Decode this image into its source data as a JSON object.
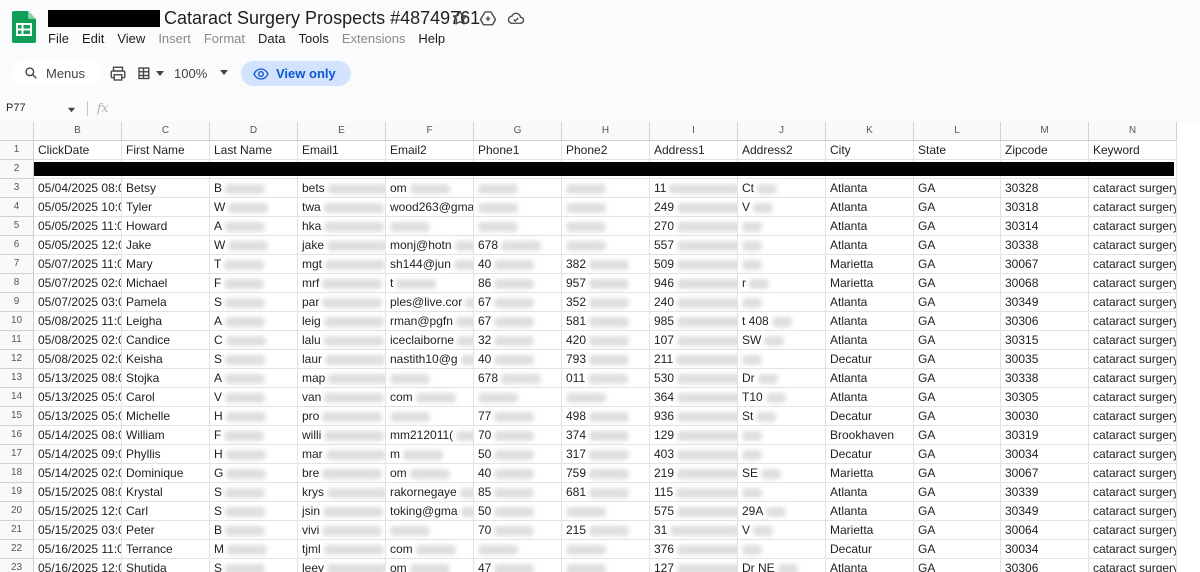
{
  "window": {
    "doc_title": "Cataract Surgery Prospects #48749761"
  },
  "menu": [
    {
      "label": "File",
      "enabled": true
    },
    {
      "label": "Edit",
      "enabled": true
    },
    {
      "label": "View",
      "enabled": true
    },
    {
      "label": "Insert",
      "enabled": false
    },
    {
      "label": "Format",
      "enabled": false
    },
    {
      "label": "Data",
      "enabled": true
    },
    {
      "label": "Tools",
      "enabled": true
    },
    {
      "label": "Extensions",
      "enabled": false
    },
    {
      "label": "Help",
      "enabled": true
    }
  ],
  "toolbar": {
    "menus_label": "Menus",
    "zoom": "100%",
    "view_only_label": "View only"
  },
  "formula_bar": {
    "cell_ref": "P77",
    "fx_label": "fx"
  },
  "colors": {
    "accent": "#0b57d0",
    "view_only_bg": "#d3e3fd",
    "sheets_green": "#0f9d58"
  },
  "grid": {
    "columns": [
      "B",
      "C",
      "D",
      "E",
      "F",
      "G",
      "H",
      "I",
      "J",
      "K",
      "L",
      "M",
      "N"
    ],
    "headers": [
      "ClickDate",
      "First Name",
      "Last Name",
      "Email1",
      "Email2",
      "Phone1",
      "Phone2",
      "Address1",
      "Address2",
      "City",
      "State",
      "Zipcode",
      "Keyword"
    ],
    "row_numbers": [
      "1",
      "2",
      "3",
      "4",
      "5",
      "6",
      "7",
      "8",
      "9",
      "10",
      "11",
      "12",
      "13",
      "14",
      "15",
      "16",
      "17",
      "18",
      "19",
      "20",
      "21",
      "22",
      "23"
    ],
    "rows": [
      [
        "05/04/2025 08:0",
        "Betsy",
        "B",
        "bets",
        "om",
        "",
        "",
        "11",
        "Ct",
        "Atlanta",
        "GA",
        "30328",
        "cataract surgery"
      ],
      [
        "05/05/2025 10:0",
        "Tyler",
        "W",
        "twa",
        "wood263@gma",
        "",
        "",
        "249",
        "V",
        "Atlanta",
        "GA",
        "30318",
        "cataract surgery"
      ],
      [
        "05/05/2025 11:0",
        "Howard",
        "A",
        "hka",
        "",
        "",
        "",
        "270",
        "",
        "Atlanta",
        "GA",
        "30314",
        "cataract surgery"
      ],
      [
        "05/05/2025 12:0",
        "Jake",
        "W",
        "jake",
        "monj@hotn",
        "678",
        "",
        "557",
        "",
        "Atlanta",
        "GA",
        "30338",
        "cataract surgery"
      ],
      [
        "05/07/2025 11:0",
        "Mary",
        "T",
        "mgt",
        "sh144@jun",
        "40",
        "382",
        "509",
        "",
        "Marietta",
        "GA",
        "30067",
        "cataract surgery"
      ],
      [
        "05/07/2025 02:0",
        "Michael",
        "F",
        "mrf",
        "t",
        "86",
        "957",
        "946",
        "r",
        "Marietta",
        "GA",
        "30068",
        "cataract surgery"
      ],
      [
        "05/07/2025 03:0",
        "Pamela",
        "S",
        "par",
        "ples@live.cor",
        "67",
        "352",
        "240",
        "",
        "Atlanta",
        "GA",
        "30349",
        "cataract surgery"
      ],
      [
        "05/08/2025 11:0",
        "Leigha",
        "A",
        "leig",
        "rman@pgfn",
        "67",
        "581",
        "985",
        "t 408",
        "Atlanta",
        "GA",
        "30306",
        "cataract surgery"
      ],
      [
        "05/08/2025 02:0",
        "Candice",
        "C",
        "lalu",
        "iceclaiborne",
        "32",
        "420",
        "107",
        "SW",
        "Atlanta",
        "GA",
        "30315",
        "cataract surgery"
      ],
      [
        "05/08/2025 02:0",
        "Keisha",
        "S",
        "laur",
        "nastith10@g",
        "40",
        "793",
        "211",
        "",
        "Decatur",
        "GA",
        "30035",
        "cataract surgery"
      ],
      [
        "05/13/2025 08:0",
        "Stojka",
        "A",
        "map",
        "",
        "678",
        "011",
        "530",
        "Dr",
        "Atlanta",
        "GA",
        "30338",
        "cataract surgery"
      ],
      [
        "05/13/2025 05:0",
        "Carol",
        "V",
        "van",
        "com",
        "",
        "",
        "364",
        "T10",
        "Atlanta",
        "GA",
        "30305",
        "cataract surgery"
      ],
      [
        "05/13/2025 05:0",
        "Michelle",
        "H",
        "pro",
        "",
        "77",
        "498",
        "936",
        "St",
        "Decatur",
        "GA",
        "30030",
        "cataract surgery"
      ],
      [
        "05/14/2025 08:0",
        "William",
        "F",
        "willi",
        "mm212011(",
        "70",
        "374",
        "129",
        "",
        "Brookhaven",
        "GA",
        "30319",
        "cataract surgery"
      ],
      [
        "05/14/2025 09:0",
        "Phyllis",
        "H",
        "mar",
        "m",
        "50",
        "317",
        "403",
        "",
        "Decatur",
        "GA",
        "30034",
        "cataract surgery"
      ],
      [
        "05/14/2025 02:0",
        "Dominique",
        "G",
        "bre",
        "om",
        "40",
        "759",
        "219",
        "SE",
        "Marietta",
        "GA",
        "30067",
        "cataract surgery"
      ],
      [
        "05/15/2025 08:0",
        "Krystal",
        "S",
        "krys",
        "rakornegaye",
        "85",
        "681",
        "115",
        "",
        "Atlanta",
        "GA",
        "30339",
        "cataract surgery"
      ],
      [
        "05/15/2025 12:0",
        "Carl",
        "S",
        "jsin",
        "toking@gma",
        "50",
        "",
        "575",
        "29A",
        "Atlanta",
        "GA",
        "30349",
        "cataract surgery"
      ],
      [
        "05/15/2025 03:0",
        "Peter",
        "B",
        "vivi",
        "",
        "70",
        "215",
        "31",
        "V",
        "Marietta",
        "GA",
        "30064",
        "cataract surgery"
      ],
      [
        "05/16/2025 11:0",
        "Terrance",
        "M",
        "tjml",
        "com",
        "",
        "",
        "376",
        "",
        "Decatur",
        "GA",
        "30034",
        "cataract surgery"
      ],
      [
        "05/16/2025 12:0",
        "Shutida",
        "S",
        "leey",
        "om",
        "47",
        "",
        "127",
        "Dr NE",
        "Atlanta",
        "GA",
        "30306",
        "cataract surgery"
      ]
    ]
  }
}
